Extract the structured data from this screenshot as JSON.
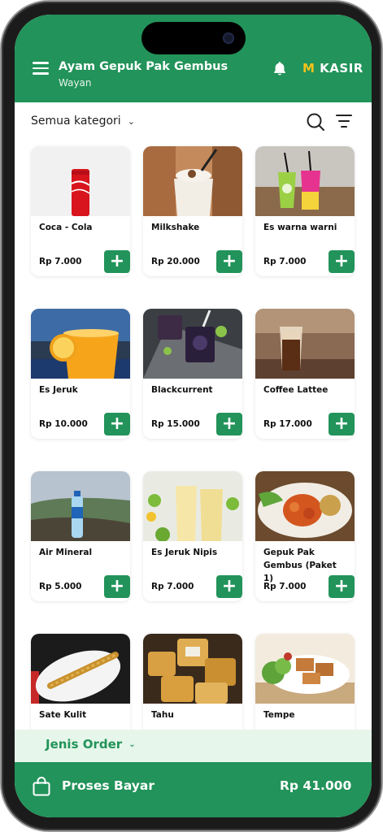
{
  "header": {
    "store_name": "Ayam Gepuk Pak Gembus",
    "cashier_name": "Wayan",
    "brand_prefix": "M",
    "brand_name": "KASIR",
    "brand_accent": "#f3c21b",
    "color": "#22935a"
  },
  "toolbar": {
    "category": "Semua kategori"
  },
  "products": [
    {
      "name": "Coca - Cola",
      "price": "Rp 7.000",
      "add": "+"
    },
    {
      "name": "Milkshake",
      "price": "Rp 20.000",
      "add": "+"
    },
    {
      "name": "Es warna warni",
      "price": "Rp 7.000",
      "add": "+"
    },
    {
      "name": "Es Jeruk",
      "price": "Rp 10.000",
      "add": "+"
    },
    {
      "name": "Blackcurrent",
      "price": "Rp 15.000",
      "add": "+"
    },
    {
      "name": "Coffee Lattee",
      "price": "Rp 17.000",
      "add": "+"
    },
    {
      "name": "Air Mineral",
      "price": "Rp 5.000",
      "add": "+"
    },
    {
      "name": "Es Jeruk Nipis",
      "price": "Rp 7.000",
      "add": "+"
    },
    {
      "name": "Gepuk Pak Gembus (Paket 1)",
      "price": "Rp 7.000",
      "add": "+"
    },
    {
      "name": "Sate Kulit",
      "price": "",
      "add": ""
    },
    {
      "name": "Tahu",
      "price": "",
      "add": ""
    },
    {
      "name": "Tempe",
      "price": "",
      "add": ""
    }
  ],
  "order": {
    "label": "Jenis Order"
  },
  "pay": {
    "label": "Proses Bayar",
    "total": "Rp 41.000"
  }
}
